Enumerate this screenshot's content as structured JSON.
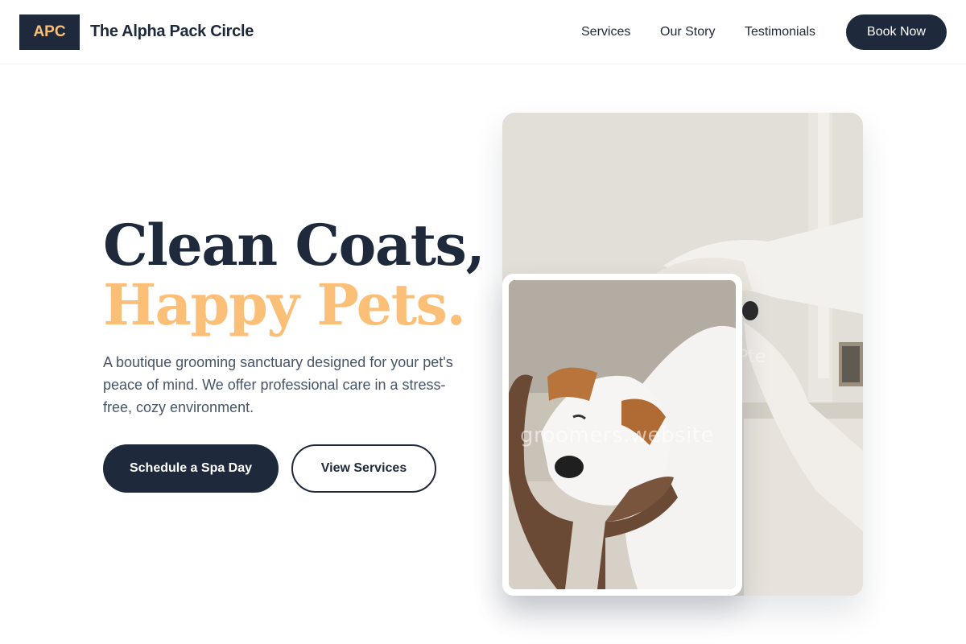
{
  "header": {
    "logo_text": "APC",
    "brand_name": "The Alpha Pack Circle",
    "nav": [
      "Services",
      "Our Story",
      "Testimonials"
    ],
    "cta_label": "Book Now"
  },
  "hero": {
    "headline_line1": "Clean Coats,",
    "headline_line2": "Happy Pets.",
    "description": "A boutique grooming sanctuary designed for your pet's peace of mind. We offer professional care in a stress-free, cozy environment.",
    "primary_button": "Schedule a Spa Day",
    "secondary_button": "View Services"
  },
  "images": {
    "back_photo": "groomer-hands-dog-photo",
    "front_photo": "puppy-in-hands-photo",
    "watermark": "groomers.website"
  },
  "colors": {
    "navy": "#1e293b",
    "accent_peach": "#fbbf77",
    "body_text": "#475569"
  }
}
